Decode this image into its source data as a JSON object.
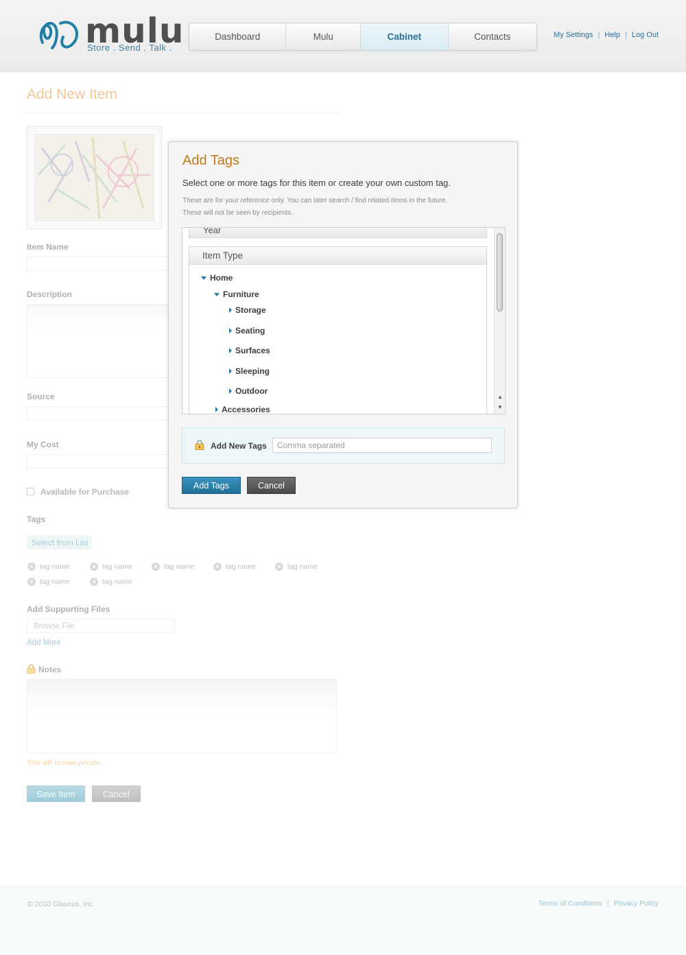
{
  "brand": {
    "name": "mulu",
    "tagline": "Store . Send . Talk .",
    "accent": "#2c79a8"
  },
  "nav": {
    "tabs": [
      {
        "label": "Dashboard",
        "active": false
      },
      {
        "label": "Mulu",
        "active": false
      },
      {
        "label": "Cabinet",
        "active": true
      },
      {
        "label": "Contacts",
        "active": false
      }
    ]
  },
  "toplinks": {
    "settings": "My Settings",
    "help": "Help",
    "logout": "Log Out",
    "sep": "|"
  },
  "form": {
    "title": "Add New Item",
    "item_name_label": "Item Name",
    "description_label": "Description",
    "source_label": "Source",
    "cost_label": "My Cost",
    "available_label": "Available for Purchase",
    "tags_label": "Tags",
    "select_from_list": "Select from List",
    "tags": [
      "tag name",
      "tag name",
      "tag name",
      "tag name",
      "tag name",
      "tag name",
      "tag name"
    ],
    "supporting_files_label": "Add Supporting Files",
    "browse_placeholder": "Browse File",
    "add_more": "Add More",
    "notes_label": "Notes",
    "private_note": "This will remain private.",
    "save_button": "Save Item",
    "cancel_button": "Cancel"
  },
  "modal": {
    "title": "Add Tags",
    "subtitle": "Select one or more tags for this item or create your own custom tag.",
    "note_line1": "These are for your reference only. You can later search / find related items in the future.",
    "note_line2": "These will not be seen by recipients.",
    "year_group": "Year",
    "item_type_group": "Item Type",
    "tree": {
      "home": "Home",
      "furniture": "Furniture",
      "storage": "Storage",
      "seating": "Seating",
      "surfaces": "Surfaces",
      "sleeping": "Sleeping",
      "outdoor": "Outdoor",
      "accessories": "Accessories"
    },
    "new_tags_label": "Add New Tags",
    "new_tags_placeholder": "Comma separated",
    "add_button": "Add Tags",
    "cancel_button": "Cancel"
  },
  "footer": {
    "copyright": "© 2010 Glaucus, Inc",
    "terms": "Terms of Conditions",
    "privacy": "Privacy Policy",
    "sep": "|"
  }
}
